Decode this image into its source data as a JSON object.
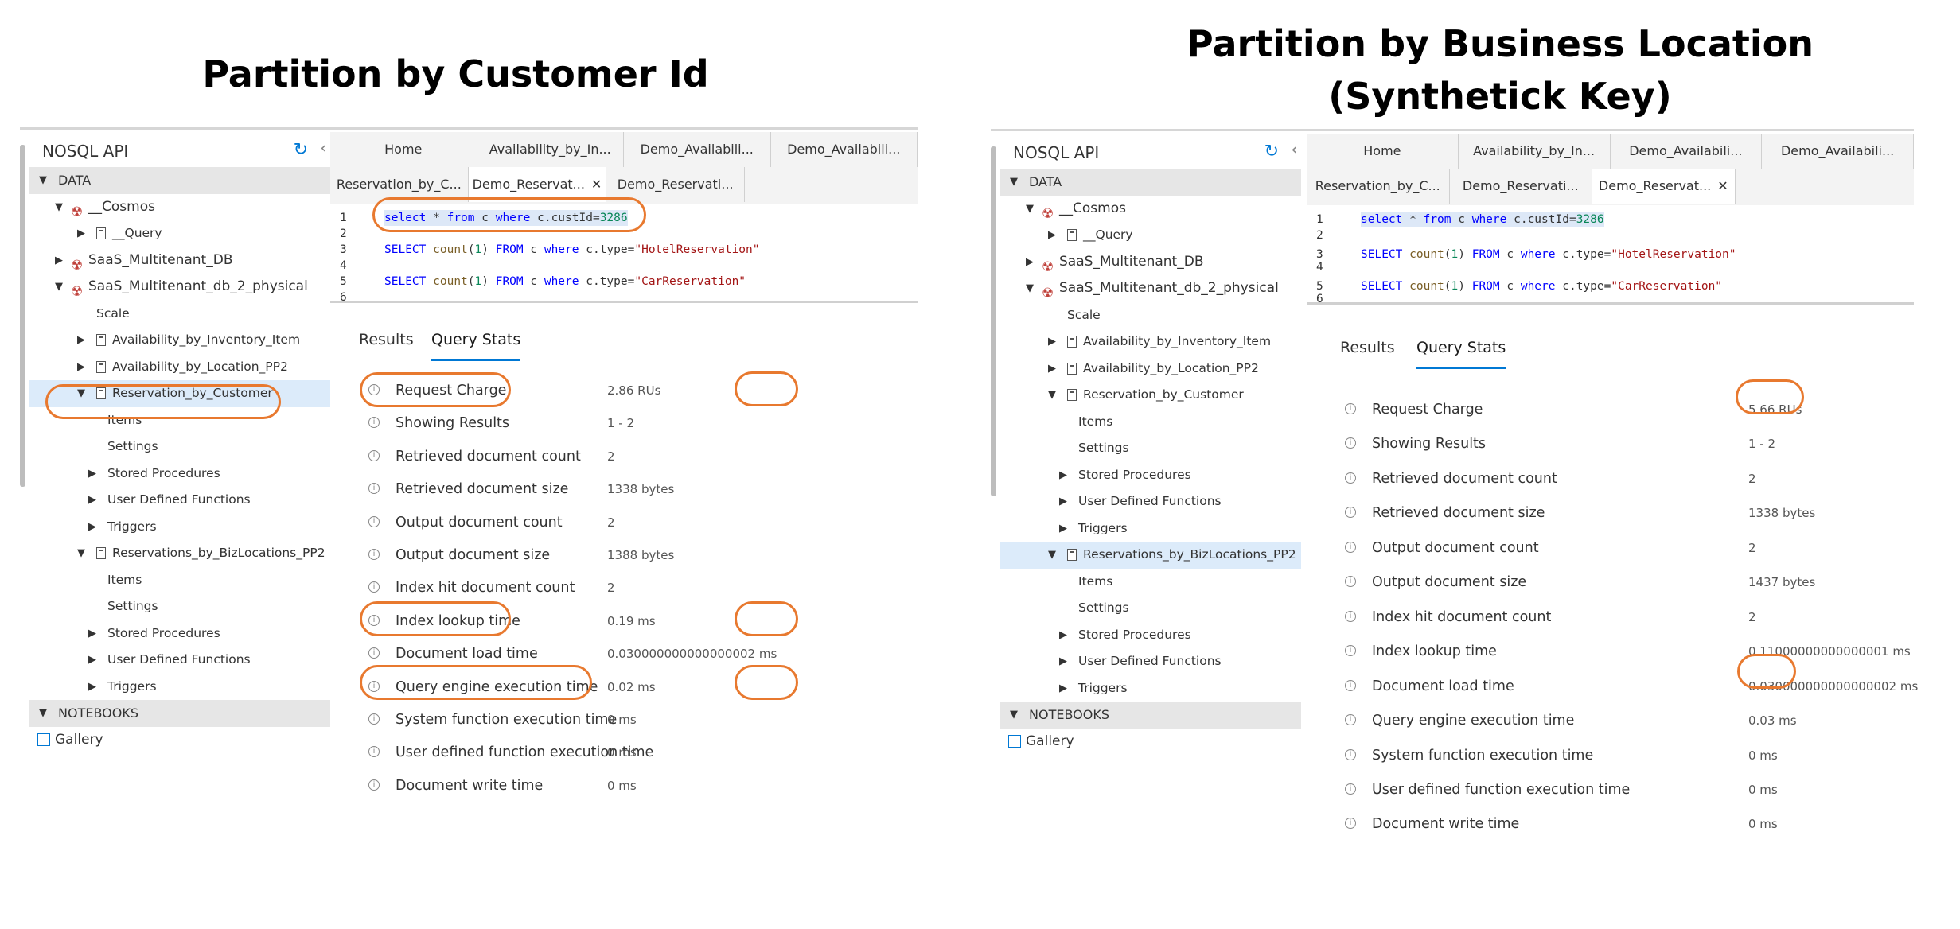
{
  "left": {
    "title": "Partition by Customer Id",
    "api_label": "NOSQL API",
    "tree": [
      {
        "label": "DATA",
        "type": "section"
      },
      {
        "label": "__Cosmos",
        "type": "db",
        "level": 1,
        "twisty": "down"
      },
      {
        "label": "__Query",
        "type": "coll",
        "level": 2,
        "twisty": "right"
      },
      {
        "label": "SaaS_Multitenant_DB",
        "type": "db",
        "level": 1,
        "twisty": "right"
      },
      {
        "label": "SaaS_Multitenant_db_2_physical",
        "type": "db",
        "level": 1,
        "twisty": "down"
      },
      {
        "label": "Scale",
        "type": "leaf",
        "level": 2
      },
      {
        "label": "Availability_by_Inventory_Item",
        "type": "coll",
        "level": 2,
        "twisty": "right"
      },
      {
        "label": "Availability_by_Location_PP2",
        "type": "coll",
        "level": 2,
        "twisty": "right"
      },
      {
        "label": "Reservation_by_Customer",
        "type": "coll",
        "level": 2,
        "twisty": "down",
        "selected": true
      },
      {
        "label": "Items",
        "type": "leaf",
        "level": 3
      },
      {
        "label": "Settings",
        "type": "leaf",
        "level": 3
      },
      {
        "label": "Stored Procedures",
        "type": "leaf",
        "level": 3,
        "twisty": "right"
      },
      {
        "label": "User Defined Functions",
        "type": "leaf",
        "level": 3,
        "twisty": "right"
      },
      {
        "label": "Triggers",
        "type": "leaf",
        "level": 3,
        "twisty": "right"
      },
      {
        "label": "Reservations_by_BizLocations_PP2",
        "type": "coll",
        "level": 2,
        "twisty": "down"
      },
      {
        "label": "Items",
        "type": "leaf",
        "level": 3
      },
      {
        "label": "Settings",
        "type": "leaf",
        "level": 3
      },
      {
        "label": "Stored Procedures",
        "type": "leaf",
        "level": 3,
        "twisty": "right"
      },
      {
        "label": "User Defined Functions",
        "type": "leaf",
        "level": 3,
        "twisty": "right"
      },
      {
        "label": "Triggers",
        "type": "leaf",
        "level": 3,
        "twisty": "right"
      },
      {
        "label": "NOTEBOOKS",
        "type": "section"
      },
      {
        "label": "Gallery",
        "type": "gallery",
        "level": 0
      }
    ],
    "tabs_row1": [
      "Home",
      "Availability_by_In...",
      "Demo_Availabili...",
      "Demo_Availabili..."
    ],
    "tabs_row2": [
      "Reservation_by_C...",
      "Demo_Reservat...",
      "Demo_Reservati..."
    ],
    "active_tab_row2": 1,
    "editor": [
      {
        "num": "1",
        "code": "select * from c where c.custId=3286"
      },
      {
        "num": "2",
        "code": ""
      },
      {
        "num": "3",
        "code": "SELECT count(1) FROM c where c.type=\"HotelReservation\""
      },
      {
        "num": "4",
        "code": ""
      },
      {
        "num": "5",
        "code": "SELECT count(1) FROM c where c.type=\"CarReservation\""
      },
      {
        "num": "6",
        "code": ""
      }
    ],
    "result_tabs": [
      "Results",
      "Query Stats"
    ],
    "stats": [
      {
        "name": "Request Charge",
        "value": "2.86 RUs"
      },
      {
        "name": "Showing Results",
        "value": "1 - 2"
      },
      {
        "name": "Retrieved document count",
        "value": "2"
      },
      {
        "name": "Retrieved document size",
        "value": "1338 bytes"
      },
      {
        "name": "Output document count",
        "value": "2"
      },
      {
        "name": "Output document size",
        "value": "1388 bytes"
      },
      {
        "name": "Index hit document count",
        "value": "2"
      },
      {
        "name": "Index lookup time",
        "value": "0.19 ms"
      },
      {
        "name": "Document load time",
        "value": "0.030000000000000002 ms"
      },
      {
        "name": "Query engine execution time",
        "value": "0.02 ms"
      },
      {
        "name": "System function execution time",
        "value": "0 ms"
      },
      {
        "name": "User defined function execution time",
        "value": "0 ms"
      },
      {
        "name": "Document write time",
        "value": "0 ms"
      }
    ]
  },
  "right": {
    "title_line1": "Partition by Business Location",
    "title_line2": "(Synthetick Key)",
    "api_label": "NOSQL API",
    "tree": [
      {
        "label": "DATA",
        "type": "section"
      },
      {
        "label": "__Cosmos",
        "type": "db",
        "level": 1,
        "twisty": "down"
      },
      {
        "label": "__Query",
        "type": "coll",
        "level": 2,
        "twisty": "right"
      },
      {
        "label": "SaaS_Multitenant_DB",
        "type": "db",
        "level": 1,
        "twisty": "right"
      },
      {
        "label": "SaaS_Multitenant_db_2_physical",
        "type": "db",
        "level": 1,
        "twisty": "down"
      },
      {
        "label": "Scale",
        "type": "leaf",
        "level": 2
      },
      {
        "label": "Availability_by_Inventory_Item",
        "type": "coll",
        "level": 2,
        "twisty": "right"
      },
      {
        "label": "Availability_by_Location_PP2",
        "type": "coll",
        "level": 2,
        "twisty": "right"
      },
      {
        "label": "Reservation_by_Customer",
        "type": "coll",
        "level": 2,
        "twisty": "down"
      },
      {
        "label": "Items",
        "type": "leaf",
        "level": 3
      },
      {
        "label": "Settings",
        "type": "leaf",
        "level": 3
      },
      {
        "label": "Stored Procedures",
        "type": "leaf",
        "level": 3,
        "twisty": "right"
      },
      {
        "label": "User Defined Functions",
        "type": "leaf",
        "level": 3,
        "twisty": "right"
      },
      {
        "label": "Triggers",
        "type": "leaf",
        "level": 3,
        "twisty": "right"
      },
      {
        "label": "Reservations_by_BizLocations_PP2",
        "type": "coll",
        "level": 2,
        "twisty": "down",
        "selected": true
      },
      {
        "label": "Items",
        "type": "leaf",
        "level": 3
      },
      {
        "label": "Settings",
        "type": "leaf",
        "level": 3
      },
      {
        "label": "Stored Procedures",
        "type": "leaf",
        "level": 3,
        "twisty": "right"
      },
      {
        "label": "User Defined Functions",
        "type": "leaf",
        "level": 3,
        "twisty": "right"
      },
      {
        "label": "Triggers",
        "type": "leaf",
        "level": 3,
        "twisty": "right"
      },
      {
        "label": "NOTEBOOKS",
        "type": "section"
      },
      {
        "label": "Gallery",
        "type": "gallery",
        "level": 0
      }
    ],
    "tabs_row1": [
      "Home",
      "Availability_by_In...",
      "Demo_Availabili...",
      "Demo_Availabili..."
    ],
    "tabs_row2": [
      "Reservation_by_C...",
      "Demo_Reservati...",
      "Demo_Reservat..."
    ],
    "active_tab_row2": 2,
    "editor": [
      {
        "num": "1",
        "code": "select * from c where c.custId=3286"
      },
      {
        "num": "2",
        "code": ""
      },
      {
        "num": "3",
        "code": "SELECT count(1) FROM c where c.type=\"HotelReservation\""
      },
      {
        "num": "4",
        "code": ""
      },
      {
        "num": "5",
        "code": "SELECT count(1) FROM c where c.type=\"CarReservation\""
      },
      {
        "num": "6",
        "code": ""
      }
    ],
    "result_tabs": [
      "Results",
      "Query Stats"
    ],
    "stats": [
      {
        "name": "Request Charge",
        "value": "5.66 RUs"
      },
      {
        "name": "Showing Results",
        "value": "1 - 2"
      },
      {
        "name": "Retrieved document count",
        "value": "2"
      },
      {
        "name": "Retrieved document size",
        "value": "1338 bytes"
      },
      {
        "name": "Output document count",
        "value": "2"
      },
      {
        "name": "Output document size",
        "value": "1437 bytes"
      },
      {
        "name": "Index hit document count",
        "value": "2"
      },
      {
        "name": "Index lookup time",
        "value": "0.11000000000000001 ms"
      },
      {
        "name": "Document load time",
        "value": "0.030000000000000002 ms"
      },
      {
        "name": "Query engine execution time",
        "value": "0.03 ms"
      },
      {
        "name": "System function execution time",
        "value": "0 ms"
      },
      {
        "name": "User defined function execution time",
        "value": "0 ms"
      },
      {
        "name": "Document write time",
        "value": "0 ms"
      }
    ]
  },
  "colors": {
    "highlight_oval": "#e8792f",
    "accent": "#0078d4",
    "selected_row": "#dcebfa"
  },
  "icons": {
    "refresh": "refresh-icon",
    "collapse": "chevron-left-icon",
    "info": "info-icon",
    "close": "close-icon"
  }
}
